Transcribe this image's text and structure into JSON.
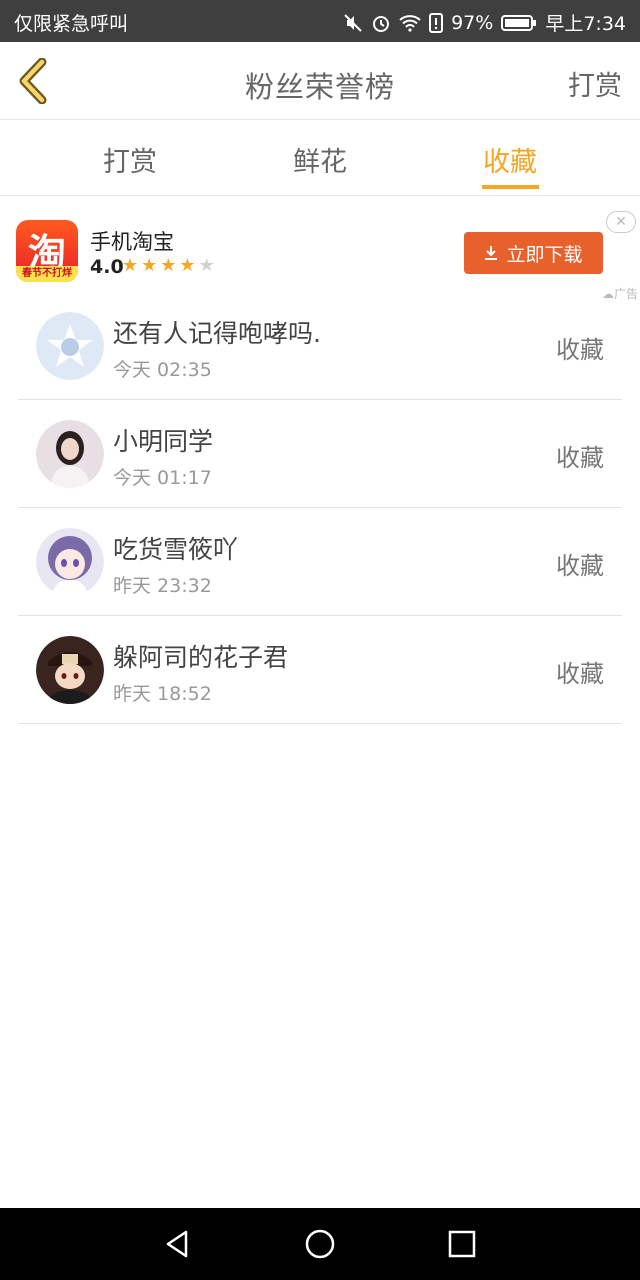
{
  "status_bar": {
    "left_text": "仅限紧急呼叫",
    "battery": "97%",
    "time": "早上7:34"
  },
  "header": {
    "title": "粉丝荣誉榜",
    "action": "打赏"
  },
  "tabs": [
    {
      "label": "打赏",
      "active": false
    },
    {
      "label": "鲜花",
      "active": false
    },
    {
      "label": "收藏",
      "active": true
    }
  ],
  "ad": {
    "icon_char": "淘",
    "icon_strip": "春节不打烊",
    "name": "手机淘宝",
    "rating": "4.0",
    "stars": 4,
    "button": "立即下载",
    "close": "✕",
    "tag": "广告"
  },
  "list": [
    {
      "name": "还有人记得咆哮吗.",
      "time": "今天 02:35",
      "action": "收藏"
    },
    {
      "name": "小明同学",
      "time": "今天 01:17",
      "action": "收藏"
    },
    {
      "name": "吃货雪筱吖",
      "time": "昨天 23:32",
      "action": "收藏"
    },
    {
      "name": "躲阿司的花子君",
      "time": "昨天 18:52",
      "action": "收藏"
    }
  ],
  "colors": {
    "accent": "#f5a623",
    "download_button": "#e8612c"
  }
}
